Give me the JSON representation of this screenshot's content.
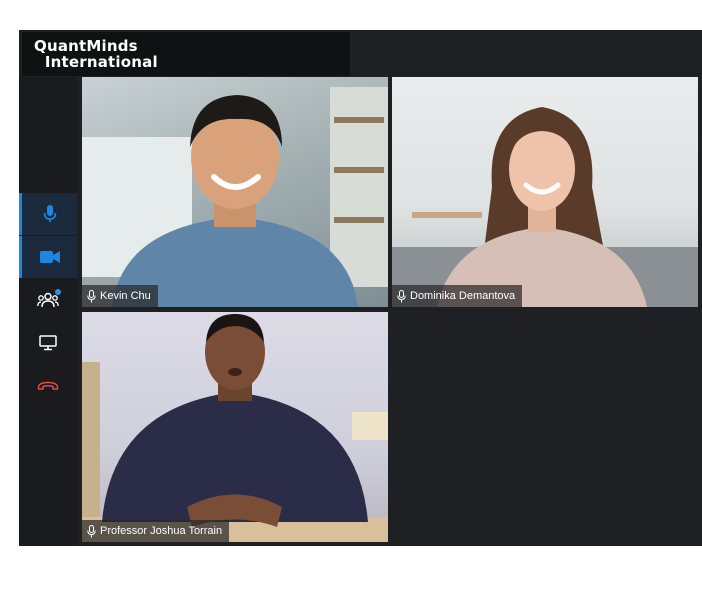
{
  "brand": {
    "line1": "QuantMinds",
    "line2": "International"
  },
  "sidebar": {
    "items": [
      {
        "name": "microphone",
        "icon": "microphone-icon",
        "active": true
      },
      {
        "name": "camera",
        "icon": "video-camera-icon",
        "active": true
      },
      {
        "name": "participants",
        "icon": "participants-icon",
        "active": false,
        "has_notification": true
      },
      {
        "name": "share-screen",
        "icon": "monitor-icon",
        "active": false
      },
      {
        "name": "hang-up",
        "icon": "phone-hangup-icon",
        "active": false
      }
    ]
  },
  "participants": [
    {
      "name": "Kevin Chu",
      "mic_icon": "microphone-icon"
    },
    {
      "name": "Dominika Demantova",
      "mic_icon": "microphone-icon"
    },
    {
      "name": "Professor Joshua Torrain",
      "mic_icon": "microphone-icon"
    }
  ],
  "colors": {
    "accent": "#1f86e0",
    "hangup": "#e04a4a",
    "background": "#1f2023"
  }
}
